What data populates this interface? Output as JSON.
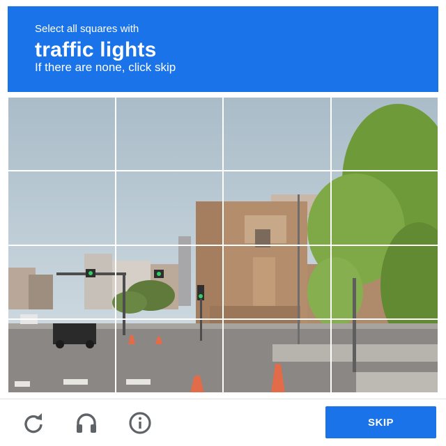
{
  "header": {
    "instruction": "Select all squares with",
    "target": "traffic lights",
    "hint": "If there are none, click skip"
  },
  "grid": {
    "rows": 4,
    "columns": 4
  },
  "footer": {
    "reload_icon": "reload-icon",
    "audio_icon": "headphones-icon",
    "info_icon": "info-icon",
    "skip_label": "SKIP"
  },
  "colors": {
    "accent": "#1a73e8",
    "icon_gray": "#5f6368"
  }
}
